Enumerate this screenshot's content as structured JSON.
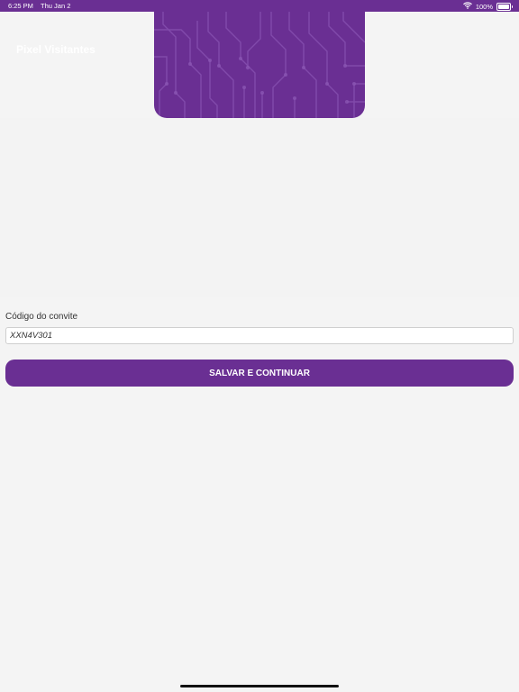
{
  "status_bar": {
    "time": "6:25 PM",
    "date": "Thu Jan 2",
    "battery": "100%",
    "wifi_icon": "wifi-icon",
    "battery_icon": "battery-full-icon"
  },
  "header": {
    "app_title": "Pixel Visitantes"
  },
  "form": {
    "invite_code_label": "Código do convite",
    "invite_code_value": "XXN4V301",
    "submit_label": "SALVAR E CONTINUAR"
  },
  "colors": {
    "brand": "#6a2f93",
    "background": "#f4f4f4"
  }
}
